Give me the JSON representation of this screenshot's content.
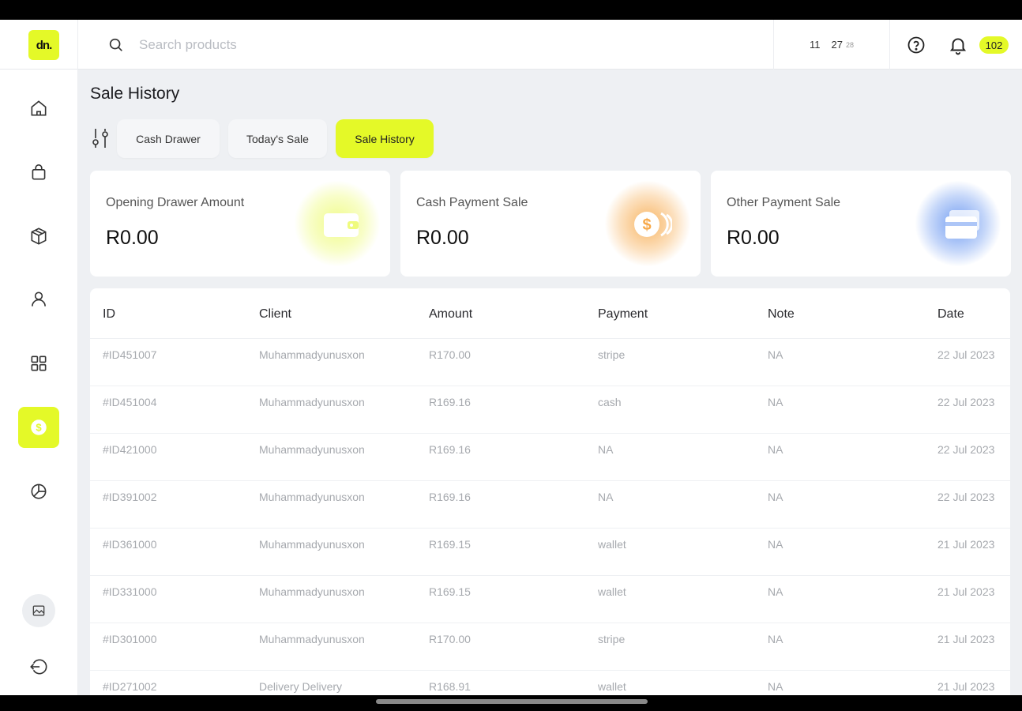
{
  "app": {
    "logo_text": "dn."
  },
  "topbar": {
    "search_placeholder": "Search products",
    "clock_hours": "11",
    "clock_minutes": "27",
    "clock_seconds": "28",
    "notification_count": "102"
  },
  "sidebar": {
    "items": [
      {
        "name": "home-icon"
      },
      {
        "name": "shopping-bag-icon"
      },
      {
        "name": "box-icon"
      },
      {
        "name": "user-icon"
      },
      {
        "name": "grid-icon"
      },
      {
        "name": "dollar-icon",
        "active": true
      },
      {
        "name": "pie-chart-icon"
      },
      {
        "name": "image-icon"
      },
      {
        "name": "logout-icon"
      }
    ]
  },
  "page": {
    "title": "Sale History",
    "tabs": [
      {
        "label": "Cash Drawer"
      },
      {
        "label": "Today's Sale"
      },
      {
        "label": "Sale History",
        "active": true
      }
    ]
  },
  "cards": [
    {
      "label": "Opening Drawer Amount",
      "amount": "R0.00",
      "icon": "wallet-icon",
      "color": "#e4f928"
    },
    {
      "label": "Cash Payment Sale",
      "amount": "R0.00",
      "icon": "coins-icon",
      "color": "#f7a94a"
    },
    {
      "label": "Other Payment Sale",
      "amount": "R0.00",
      "icon": "credit-card-icon",
      "color": "#5b8def"
    }
  ],
  "table": {
    "headers": [
      "ID",
      "Client",
      "Amount",
      "Payment",
      "Note",
      "Date"
    ],
    "rows": [
      [
        "#ID451007",
        "Muhammadyunusxon",
        "R170.00",
        "stripe",
        "NA",
        "22 Jul 2023"
      ],
      [
        "#ID451004",
        "Muhammadyunusxon",
        "R169.16",
        "cash",
        "NA",
        "22 Jul 2023"
      ],
      [
        "#ID421000",
        "Muhammadyunusxon",
        "R169.16",
        "NA",
        "NA",
        "22 Jul 2023"
      ],
      [
        "#ID391002",
        "Muhammadyunusxon",
        "R169.16",
        "NA",
        "NA",
        "22 Jul 2023"
      ],
      [
        "#ID361000",
        "Muhammadyunusxon",
        "R169.15",
        "wallet",
        "NA",
        "21 Jul 2023"
      ],
      [
        "#ID331000",
        "Muhammadyunusxon",
        "R169.15",
        "wallet",
        "NA",
        "21 Jul 2023"
      ],
      [
        "#ID301000",
        "Muhammadyunusxon",
        "R170.00",
        "stripe",
        "NA",
        "21 Jul 2023"
      ],
      [
        "#ID271002",
        "Delivery Delivery",
        "R168.91",
        "wallet",
        "NA",
        "21 Jul 2023"
      ]
    ]
  },
  "colors": {
    "accent": "#e4f928",
    "background": "#eef0f3"
  }
}
